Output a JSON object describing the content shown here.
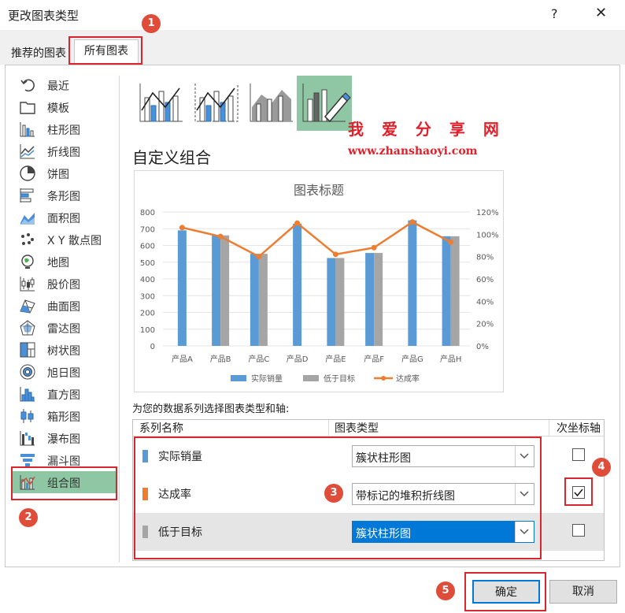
{
  "window": {
    "title": "更改图表类型",
    "help": "?",
    "close": "✕"
  },
  "tabs": [
    {
      "label": "推荐的图表"
    },
    {
      "label": "所有图表"
    }
  ],
  "nav": [
    {
      "label": "最近",
      "icon": "recent-icon"
    },
    {
      "label": "模板",
      "icon": "template-icon"
    },
    {
      "label": "柱形图",
      "icon": "column-chart-icon"
    },
    {
      "label": "折线图",
      "icon": "line-chart-icon"
    },
    {
      "label": "饼图",
      "icon": "pie-chart-icon"
    },
    {
      "label": "条形图",
      "icon": "bar-chart-icon"
    },
    {
      "label": "面积图",
      "icon": "area-chart-icon"
    },
    {
      "label": "X Y 散点图",
      "icon": "scatter-chart-icon"
    },
    {
      "label": "地图",
      "icon": "map-chart-icon"
    },
    {
      "label": "股价图",
      "icon": "stock-chart-icon"
    },
    {
      "label": "曲面图",
      "icon": "surface-chart-icon"
    },
    {
      "label": "雷达图",
      "icon": "radar-chart-icon"
    },
    {
      "label": "树状图",
      "icon": "treemap-chart-icon"
    },
    {
      "label": "旭日图",
      "icon": "sunburst-chart-icon"
    },
    {
      "label": "直方图",
      "icon": "histogram-chart-icon"
    },
    {
      "label": "箱形图",
      "icon": "box-whisker-chart-icon"
    },
    {
      "label": "瀑布图",
      "icon": "waterfall-chart-icon"
    },
    {
      "label": "漏斗图",
      "icon": "funnel-chart-icon"
    },
    {
      "label": "组合图",
      "icon": "combo-chart-icon",
      "selected": true
    }
  ],
  "combo": {
    "heading": "自定义组合",
    "subtypes": [
      "clustered-column-line-icon",
      "clustered-column-line-secondary-icon",
      "stacked-area-clustered-column-icon",
      "custom-combination-icon"
    ],
    "watermark": {
      "line1": "我 爱 分 享 网",
      "line2": "www.zhanshaoyi.com"
    }
  },
  "instruction": "为您的数据系列选择图表类型和轴:",
  "table": {
    "headers": {
      "name": "系列名称",
      "type": "图表类型",
      "secondary": "次坐标轴"
    },
    "rows": [
      {
        "name": "实际销量",
        "color": "#5b9bd5",
        "type": "簇状柱形图",
        "secondary": false
      },
      {
        "name": "达成率",
        "color": "#ed7d31",
        "type": "带标记的堆积折线图",
        "secondary": true
      },
      {
        "name": "低于目标",
        "color": "#a5a5a5",
        "type": "簇状柱形图",
        "secondary": false,
        "selected": true
      }
    ]
  },
  "buttons": {
    "ok": "确定",
    "cancel": "取消"
  },
  "annotations": [
    "1",
    "2",
    "3",
    "4",
    "5"
  ],
  "chart_data": {
    "type": "bar",
    "title": "图表标题",
    "categories": [
      "产品A",
      "产品B",
      "产品C",
      "产品D",
      "产品E",
      "产品F",
      "产品G",
      "产品H"
    ],
    "series": [
      {
        "name": "实际销量",
        "kind": "bar",
        "axis": "primary",
        "color": "#5b9bd5",
        "values": [
          690,
          660,
          550,
          730,
          525,
          555,
          750,
          655
        ]
      },
      {
        "name": "低于目标",
        "kind": "bar",
        "axis": "primary",
        "color": "#a5a5a5",
        "values": [
          null,
          660,
          550,
          null,
          525,
          555,
          null,
          655
        ]
      },
      {
        "name": "达成率",
        "kind": "line",
        "axis": "secondary",
        "color": "#ed7d31",
        "values": [
          1.06,
          0.98,
          0.8,
          1.1,
          0.82,
          0.88,
          1.11,
          0.93
        ]
      }
    ],
    "yticks": [
      "0",
      "100",
      "200",
      "300",
      "400",
      "500",
      "600",
      "700",
      "800"
    ],
    "y2ticks": [
      "0%",
      "20%",
      "40%",
      "60%",
      "80%",
      "100%",
      "120%"
    ],
    "ylim": [
      0,
      800
    ],
    "y2lim": [
      0,
      1.2
    ],
    "legend": "bottom"
  }
}
